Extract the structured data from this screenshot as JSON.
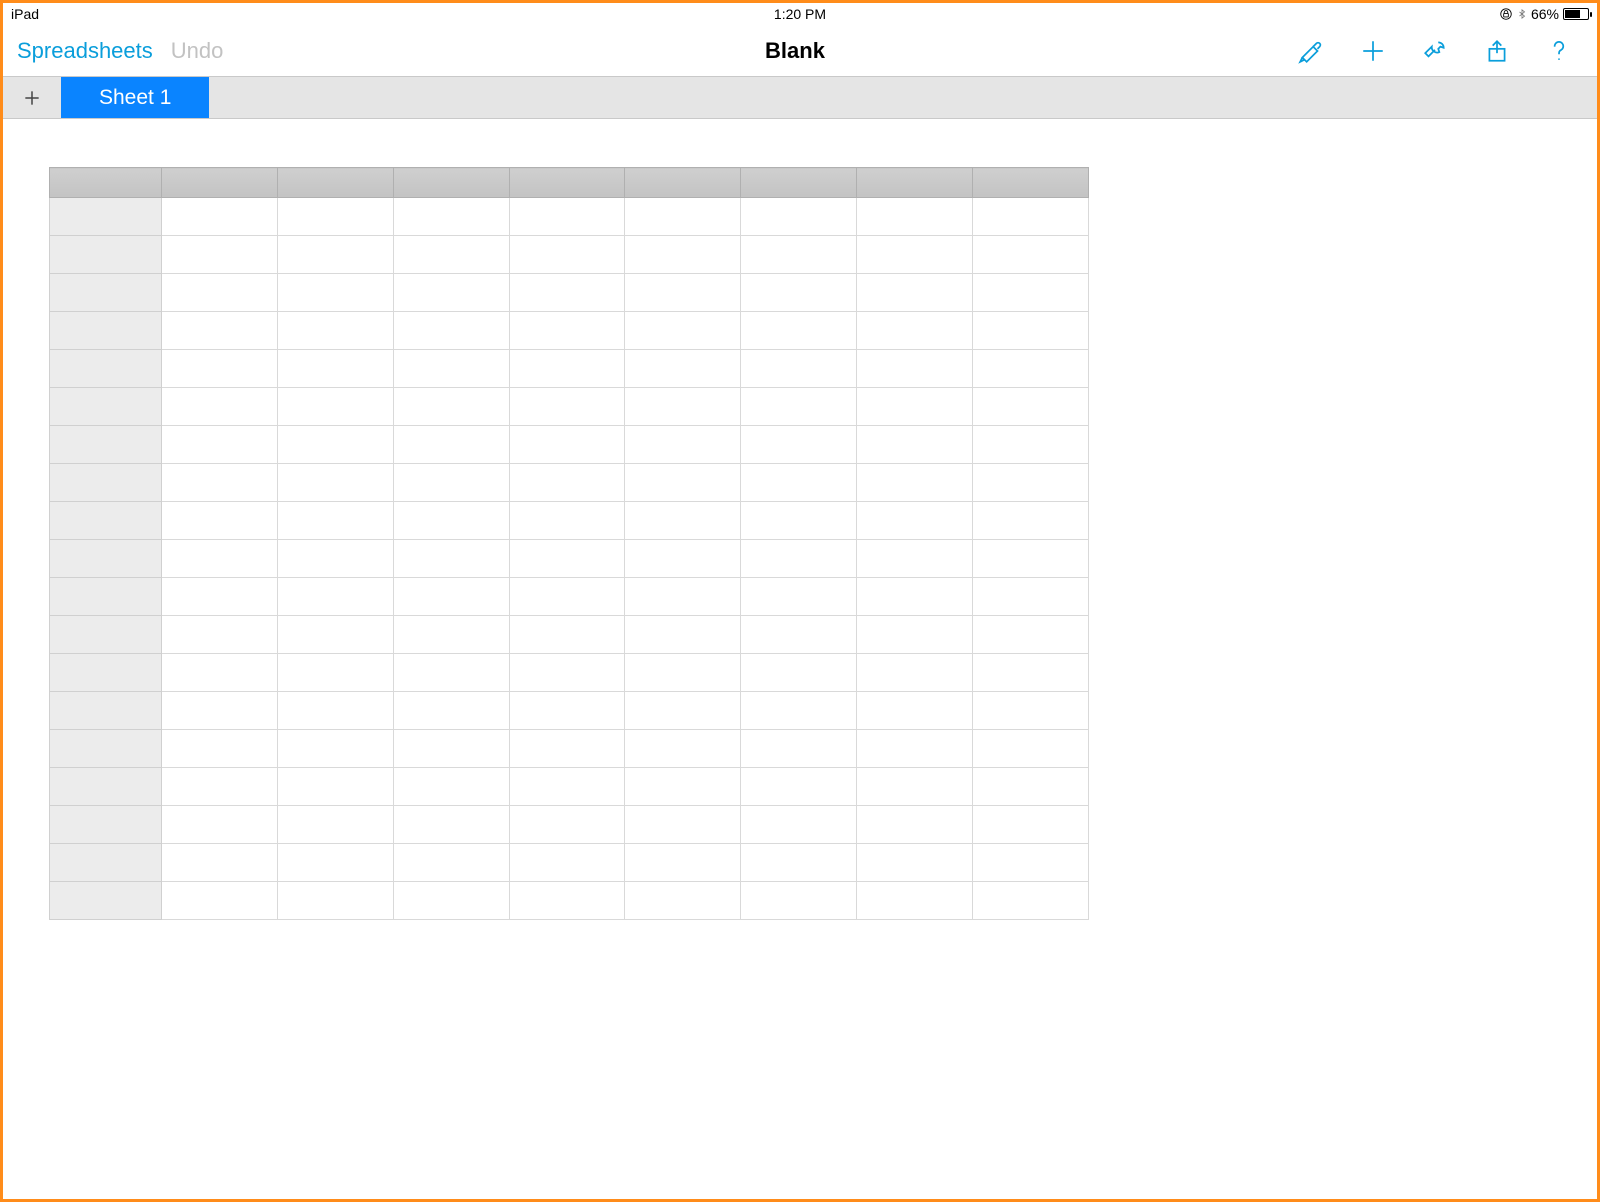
{
  "statusbar": {
    "device": "iPad",
    "time": "1:20 PM",
    "battery_percent": "66%"
  },
  "toolbar": {
    "back_label": "Spreadsheets",
    "undo_label": "Undo",
    "title": "Blank"
  },
  "tabs": {
    "sheet1_label": "Sheet 1"
  },
  "grid": {
    "columns": 9,
    "rows": 19
  },
  "colors": {
    "accent": "#0a9edb",
    "tab_active": "#0a84ff",
    "frame": "#ff8c1a"
  }
}
